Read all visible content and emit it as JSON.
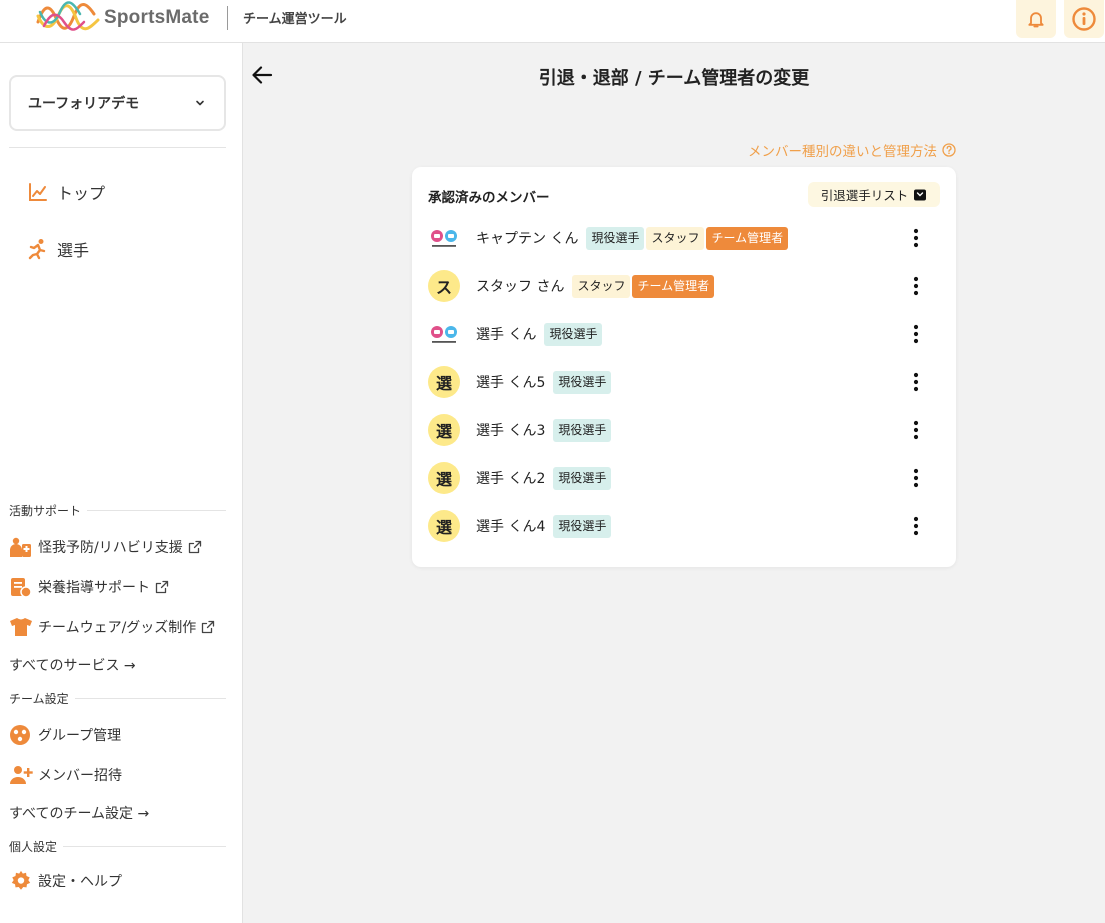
{
  "header": {
    "brand": "SportsMate",
    "subtitle": "チーム運営ツール",
    "bell_icon": "bell-icon",
    "info_icon": "info-icon",
    "accent": "#ee8a3b"
  },
  "sidebar": {
    "team_select": {
      "value": "ユーフォリアデモ"
    },
    "nav": [
      {
        "label": "トップ",
        "icon": "chart-line-icon"
      },
      {
        "label": "選手",
        "icon": "running-icon"
      }
    ],
    "activity_support": {
      "title": "活動サポート",
      "items": [
        {
          "label": "怪我予防/リハビリ支援",
          "icon": "injury-support-icon"
        },
        {
          "label": "栄養指導サポート",
          "icon": "nutrition-icon"
        },
        {
          "label": "チームウェア/グッズ制作",
          "icon": "shirt-icon"
        }
      ],
      "all_label": "すべてのサービス →"
    },
    "team_settings": {
      "title": "チーム設定",
      "items": [
        {
          "label": "グループ管理",
          "icon": "group-icon"
        },
        {
          "label": "メンバー招待",
          "icon": "user-plus-icon"
        }
      ],
      "all_label": "すべてのチーム設定 →"
    },
    "personal_settings": {
      "title": "個人設定",
      "items": [
        {
          "label": "設定・ヘルプ",
          "icon": "gear-icon"
        }
      ]
    }
  },
  "main": {
    "title": "引退・退部 / チーム管理者の変更",
    "help_link": "メンバー種別の違いと管理方法",
    "card": {
      "title": "承認済みのメンバー",
      "retired_button": "引退選手リスト",
      "members": [
        {
          "name": "キャプテン くん",
          "avatar": "logo",
          "badges": [
            {
              "label": "現役選手",
              "type": "player"
            },
            {
              "label": "スタッフ",
              "type": "staff"
            },
            {
              "label": "チーム管理者",
              "type": "admin"
            }
          ]
        },
        {
          "name": "スタッフ さん",
          "avatar": "ス",
          "badges": [
            {
              "label": "スタッフ",
              "type": "staff"
            },
            {
              "label": "チーム管理者",
              "type": "admin"
            }
          ]
        },
        {
          "name": "選手 くん",
          "avatar": "logo",
          "badges": [
            {
              "label": "現役選手",
              "type": "player"
            }
          ]
        },
        {
          "name": "選手 くん5",
          "avatar": "選",
          "badges": [
            {
              "label": "現役選手",
              "type": "player"
            }
          ]
        },
        {
          "name": "選手 くん3",
          "avatar": "選",
          "badges": [
            {
              "label": "現役選手",
              "type": "player"
            }
          ]
        },
        {
          "name": "選手 くん2",
          "avatar": "選",
          "badges": [
            {
              "label": "現役選手",
              "type": "player"
            }
          ]
        },
        {
          "name": "選手 くん4",
          "avatar": "選",
          "badges": [
            {
              "label": "現役選手",
              "type": "player"
            }
          ]
        }
      ]
    }
  }
}
